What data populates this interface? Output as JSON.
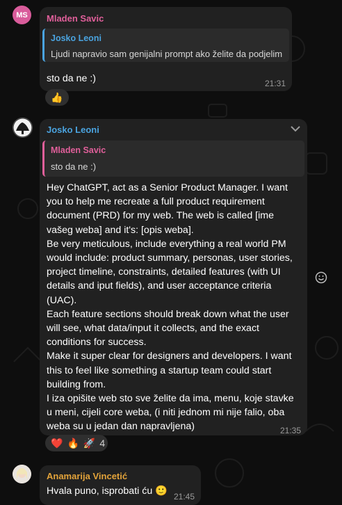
{
  "messages": [
    {
      "avatar_initials": "MS",
      "sender": "Mladen Savic",
      "sender_color": "#e05f9a",
      "reply_to": {
        "name": "Josko Leoni",
        "text": "Ljudi napravio sam genijalni prompt ako želite da podjelim",
        "color": "#4aa3df"
      },
      "text": "sto da ne :)",
      "time": "21:31",
      "reactions": [
        "👍"
      ]
    },
    {
      "sender": "Josko Leoni",
      "sender_color": "#4aa3df",
      "reply_to": {
        "name": "Mladen Savic",
        "text": "sto da ne :)",
        "color": "#e05f9a"
      },
      "text": "Hey ChatGPT, act as a Senior Product Manager. I want\nyou to help me recreate a full product requirement\ndocument (PRD) for my web. The web is called [ime\nvašeg weba] and it's: [opis weba].\nBe very meticulous, include everything a real world PM\nwould include: product summary, personas, user stories,\nproject timeline, constraints, detailed features (with UI\ndetails and iput fields), and user acceptance criteria\n(UAC).\nEach feature sections should break down what the user\nwill see, what data/input it collects, and the exact\nconditions for success.\nMake it super clear for designers and developers. I want\nthis to feel like something a startup team could start\nbuilding from.\nI iza opišite web sto sve želite da ima, menu, koje stavke\nu meni, cijeli core weba, (i niti jednom mi nije falio, oba\nweba su u jedan dan napravljena)",
      "time": "21:35",
      "reactions": [
        "❤️",
        "🔥",
        "🚀"
      ],
      "reaction_count": "4"
    },
    {
      "sender": "Anamarija Vincetić",
      "sender_color": "#e3a33a",
      "text": "Hvala puno, isprobati ću 🙂",
      "time": "21:45"
    }
  ],
  "colors": {
    "background": "#0e0e0e",
    "bubble": "#212121"
  }
}
